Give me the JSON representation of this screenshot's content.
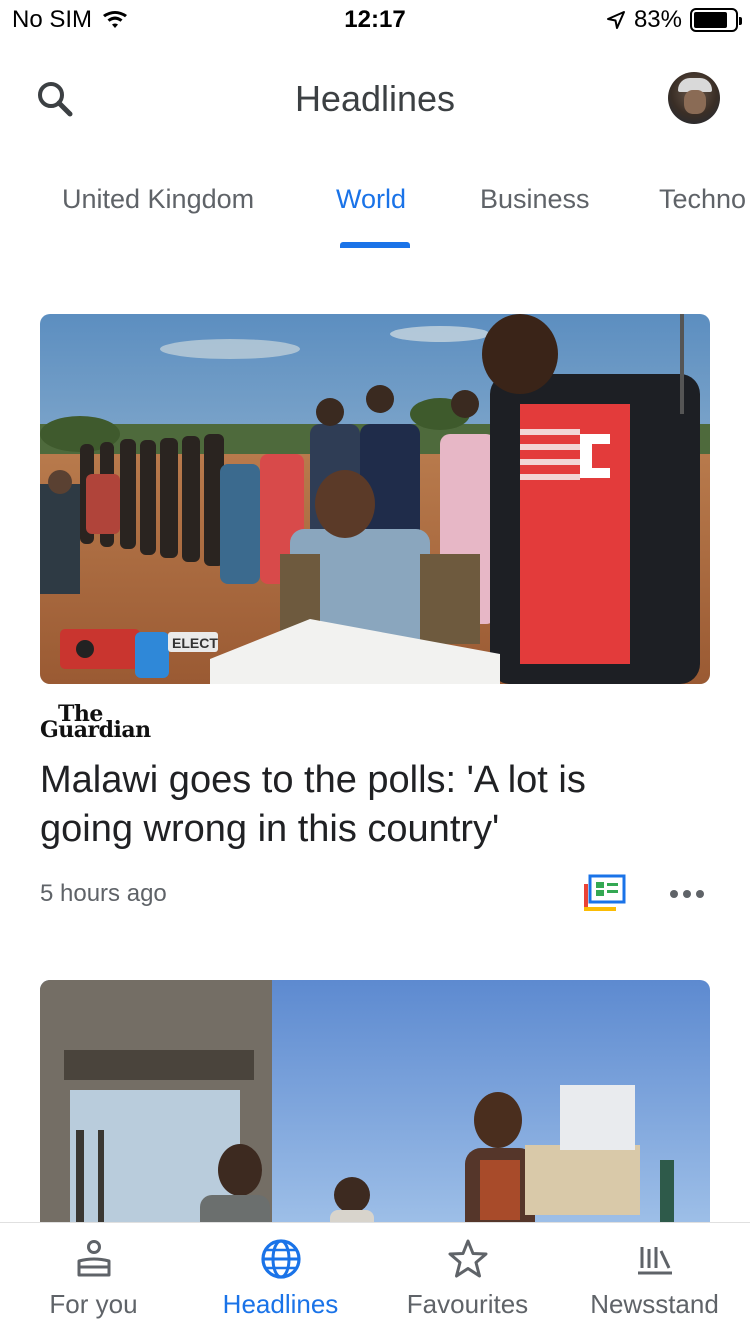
{
  "status_bar": {
    "carrier": "No SIM",
    "time": "12:17",
    "battery": "83%",
    "battery_level": 0.83
  },
  "header": {
    "title": "Headlines"
  },
  "tabs": [
    {
      "label": "United Kingdom",
      "active": false
    },
    {
      "label": "World",
      "active": true
    },
    {
      "label": "Business",
      "active": false
    },
    {
      "label": "Techno",
      "active": false
    }
  ],
  "articles": [
    {
      "source_logo": {
        "line1": "The",
        "line2": "Guardian"
      },
      "headline": "Malawi goes to the polls: 'A lot is going wrong in this country'",
      "time": "5 hours ago",
      "image_text": "ELECT"
    }
  ],
  "bottom_nav": [
    {
      "label": "For you",
      "icon": "person-icon",
      "active": false
    },
    {
      "label": "Headlines",
      "icon": "globe-icon",
      "active": true
    },
    {
      "label": "Favourites",
      "icon": "star-icon",
      "active": false
    },
    {
      "label": "Newsstand",
      "icon": "newsstand-icon",
      "active": false
    }
  ],
  "colors": {
    "accent": "#1a73e8",
    "text": "#202124",
    "secondary": "#5f6368"
  }
}
